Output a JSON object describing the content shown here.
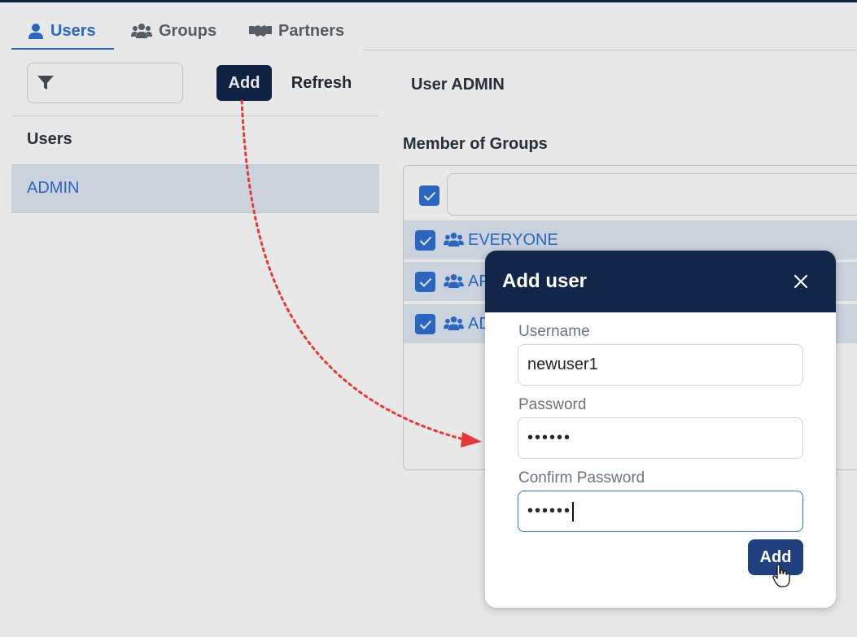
{
  "tabs": [
    {
      "label": "Users",
      "icon": "user-icon",
      "active": true
    },
    {
      "label": "Groups",
      "icon": "users-group-icon",
      "active": false
    },
    {
      "label": "Partners",
      "icon": "handshake-icon",
      "active": false
    }
  ],
  "toolbar": {
    "filter_placeholder": "",
    "add_label": "Add",
    "refresh_label": "Refresh"
  },
  "users_list": {
    "header": "Users",
    "items": [
      "ADMIN"
    ]
  },
  "detail": {
    "title": "User ADMIN",
    "member_of_title": "Member of Groups",
    "groups": [
      {
        "name": "EVERYONE",
        "checked": true
      },
      {
        "name": "AP",
        "checked": true
      },
      {
        "name": "AD",
        "checked": true
      }
    ]
  },
  "modal": {
    "title": "Add user",
    "username_label": "Username",
    "username_value": "newuser1",
    "password_label": "Password",
    "password_value": "••••••",
    "confirm_label": "Confirm Password",
    "confirm_value": "••••••",
    "add_label": "Add"
  },
  "colors": {
    "navy": "#12264a",
    "accent": "#2f6fd4",
    "row_highlight": "#dde7f3",
    "annotation_arrow": "#e53935"
  }
}
